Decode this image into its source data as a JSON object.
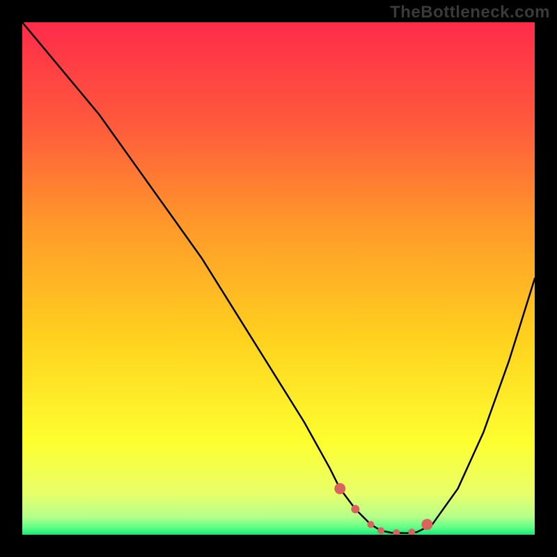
{
  "watermark": "TheBottleneck.com",
  "colors": {
    "frame_bg": "#000000",
    "curve_stroke": "#000000",
    "marker_fill": "#d9645f",
    "watermark": "#3a3a3a"
  },
  "gradient_stops": [
    {
      "offset": 0.0,
      "color": "#ff2b4a"
    },
    {
      "offset": 0.2,
      "color": "#ff5a3c"
    },
    {
      "offset": 0.4,
      "color": "#ff9a2a"
    },
    {
      "offset": 0.62,
      "color": "#ffd21e"
    },
    {
      "offset": 0.82,
      "color": "#fdff30"
    },
    {
      "offset": 0.92,
      "color": "#e8ff6a"
    },
    {
      "offset": 0.965,
      "color": "#b6ff8a"
    },
    {
      "offset": 0.985,
      "color": "#63ff88"
    },
    {
      "offset": 1.0,
      "color": "#18e876"
    }
  ],
  "chart_data": {
    "type": "line",
    "title": "",
    "xlabel": "",
    "ylabel": "",
    "xlim": [
      0,
      100
    ],
    "ylim": [
      0,
      100
    ],
    "series": [
      {
        "name": "bottleneck-curve",
        "x": [
          0,
          5,
          10,
          15,
          20,
          25,
          30,
          35,
          40,
          45,
          50,
          55,
          60,
          62,
          65,
          68,
          70,
          72,
          75,
          77,
          80,
          85,
          90,
          95,
          100
        ],
        "y": [
          100,
          94,
          88,
          82,
          75,
          68,
          61,
          54,
          46,
          38,
          30,
          22,
          13,
          9,
          5,
          2,
          0.8,
          0.4,
          0.3,
          0.5,
          2,
          9,
          20,
          34,
          50
        ]
      }
    ],
    "markers": {
      "name": "optimal-range",
      "x": [
        62,
        65,
        68,
        70,
        73,
        76,
        79
      ],
      "y": [
        9,
        5,
        2,
        0.8,
        0.4,
        0.5,
        2
      ],
      "radii": [
        8,
        6,
        5,
        5,
        5,
        5,
        8
      ]
    }
  }
}
